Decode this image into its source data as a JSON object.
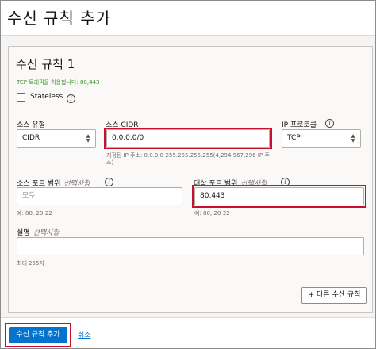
{
  "window": {
    "title": "수신 규칙 추가"
  },
  "rule": {
    "title": "수신 규칙 1",
    "hint": "TCP 트래픽을 허용합니다: 80,443",
    "stateless_label": "Stateless"
  },
  "source_type": {
    "label": "소스 유형",
    "value": "CIDR"
  },
  "source_cidr": {
    "label": "소스 CIDR",
    "value": "0.0.0.0/0",
    "help_line1": "지정된 IP 주소: 0.0.0.0-255.255.255.255(4,294,967,296 IP 주",
    "help_line2": "소)"
  },
  "ip_protocol": {
    "label": "IP 프로토콜",
    "value": "TCP"
  },
  "source_port": {
    "label": "소스 포트 범위",
    "optional": "선택사항",
    "placeholder": "모두",
    "example": "예: 80, 20-22"
  },
  "dest_port": {
    "label": "대상 포트 범위",
    "optional": "선택사항",
    "value": "80,443",
    "example": "예: 80, 20-22"
  },
  "description": {
    "label": "설명",
    "optional": "선택사항",
    "value": "",
    "max_hint": "최대 255자"
  },
  "buttons": {
    "add_another": "+ 다른 수신 규칙",
    "submit": "수신 규칙 추가",
    "cancel": "취소"
  },
  "icons": {
    "info": "info-icon",
    "select": "select-arrows-icon"
  },
  "colors": {
    "primary": "#0572ce",
    "highlight": "#c8102e",
    "hint_green": "#3b8c2b"
  }
}
